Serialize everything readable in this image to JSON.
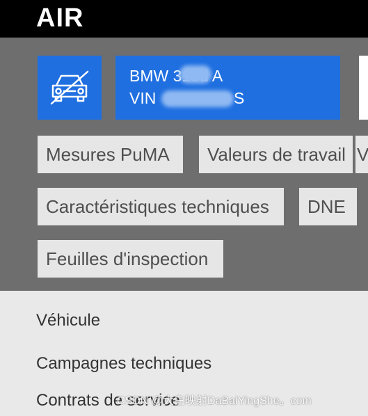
{
  "app": {
    "logo": "AIR"
  },
  "vehicle": {
    "model_line": "BMW 318d A",
    "vin_line": "VIN",
    "vin_end": "S",
    "icon": "car-icon"
  },
  "chips": [
    "Mesures PuMA",
    "Valeurs de travail",
    "V",
    "Caractéristiques techniques",
    "DNE",
    "Feuilles d'inspection"
  ],
  "menu": {
    "items": [
      "Véhicule",
      "Campagnes techniques",
      "Contrats de service"
    ]
  },
  "watermark": "CSDN @大白映射DaBaiYingShe。com",
  "colors": {
    "accent": "#1f6fe0",
    "topbar": "#000000",
    "background": "#6e6e6e",
    "chip": "#e6e6e6",
    "menu": "#e9e9e9"
  }
}
